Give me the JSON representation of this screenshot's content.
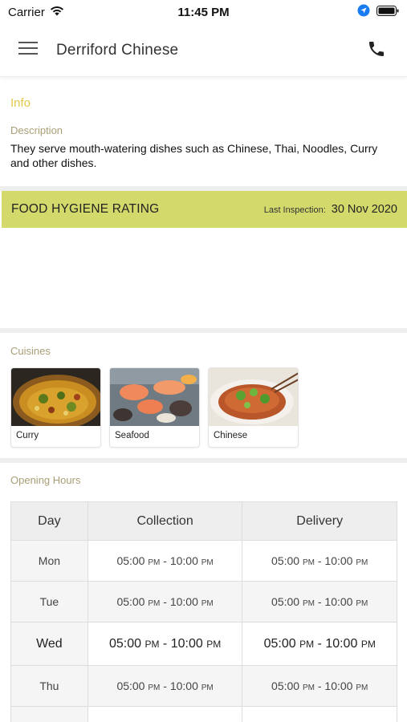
{
  "status_bar": {
    "carrier": "Carrier",
    "time": "11:45 PM"
  },
  "header": {
    "title": "Derriford Chinese",
    "menu_icon": "hamburger-menu-icon",
    "phone_icon": "phone-icon"
  },
  "info": {
    "heading": "Info",
    "description_label": "Description",
    "description": "They serve mouth-watering dishes such as Chinese, Thai, Noodles, Curry and other dishes."
  },
  "hygiene": {
    "title": "FOOD HYGIENE RATING",
    "last_inspection_label": "Last Inspection:",
    "last_inspection_date": "30 Nov 2020",
    "bar_color": "#d3da6b"
  },
  "cuisines": {
    "label": "Cuisines",
    "items": [
      {
        "name": "Curry"
      },
      {
        "name": "Seafood"
      },
      {
        "name": "Chinese"
      }
    ]
  },
  "opening_hours": {
    "label": "Opening Hours",
    "columns": [
      "Day",
      "Collection",
      "Delivery"
    ],
    "rows": [
      {
        "day": "Mon",
        "collection": {
          "open": "05:00",
          "close": "10:00"
        },
        "delivery": {
          "open": "05:00",
          "close": "10:00"
        }
      },
      {
        "day": "Tue",
        "collection": {
          "open": "05:00",
          "close": "10:00"
        },
        "delivery": {
          "open": "05:00",
          "close": "10:00"
        }
      },
      {
        "day": "Wed",
        "collection": {
          "open": "05:00",
          "close": "10:00"
        },
        "delivery": {
          "open": "05:00",
          "close": "10:00"
        }
      },
      {
        "day": "Thu",
        "collection": {
          "open": "05:00",
          "close": "10:00"
        },
        "delivery": {
          "open": "05:00",
          "close": "10:00"
        }
      }
    ],
    "ampm": "PM",
    "separator": " - "
  },
  "colors": {
    "accent_gold": "#e3c848",
    "label_muted": "#a99f76"
  }
}
